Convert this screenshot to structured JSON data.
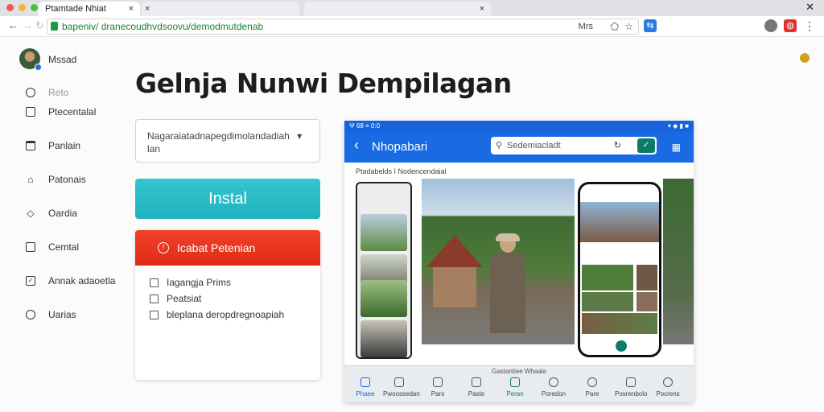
{
  "browser": {
    "tabs": [
      {
        "label": "Ptamtade Nhiat",
        "close": "×"
      },
      {
        "label": "",
        "close": "×"
      },
      {
        "label": "",
        "close": "×"
      }
    ],
    "window_close": "✕",
    "url": "bapeniv/ dranecoudhvdsoovu/demodmutdenab",
    "url_suffix": "Mrs",
    "nav_back": "←",
    "nav_forward": "→",
    "nav_reload": "↻"
  },
  "sidebar": {
    "user_name": "Mssad",
    "items": [
      {
        "label": "Reto",
        "icon": "clock-icon"
      },
      {
        "label": "Ptecentalal",
        "icon": "square-icon"
      },
      {
        "label": "Panlain",
        "icon": "calendar-icon"
      },
      {
        "label": "Patonais",
        "icon": "home-icon"
      },
      {
        "label": "Oardia",
        "icon": "tag-icon"
      },
      {
        "label": "Cemtal",
        "icon": "square-icon"
      },
      {
        "label": "Annak adaoetla",
        "icon": "check-square-icon"
      },
      {
        "label": "Uarias",
        "icon": "circle-icon"
      }
    ]
  },
  "main": {
    "title": "Gelnja Nunwi Dempilagan",
    "select_text": "Nagaraiatadnapegdimolandadiah",
    "select_text2": "lan",
    "install_label": "Instal",
    "red_button_label": "Icabat Petenian",
    "checkboxes": [
      "Iagangja Prims",
      "Peatsiat",
      "bleplana deropdregnoapiah"
    ]
  },
  "preview": {
    "status_left": "Ψ 68 ≡ 0:0",
    "status_right": "▾ ◆ ▮ ■",
    "app_title": "Nhopabari",
    "search_placeholder": "Sedemiacladt",
    "breadcrumb": "Ptadabelds  I  Nodencendaial",
    "bottom_label": "Gastantiee Whaala",
    "nav_items": [
      "Phaee",
      "Pwoossedan",
      "Pars",
      "Paste",
      "Peran",
      "Poredon",
      "Pare",
      "Posrenbolo",
      "Pocrens"
    ]
  },
  "colors": {
    "install": "#22b8c2",
    "danger": "#e5321b",
    "appbar": "#1a6be3"
  }
}
